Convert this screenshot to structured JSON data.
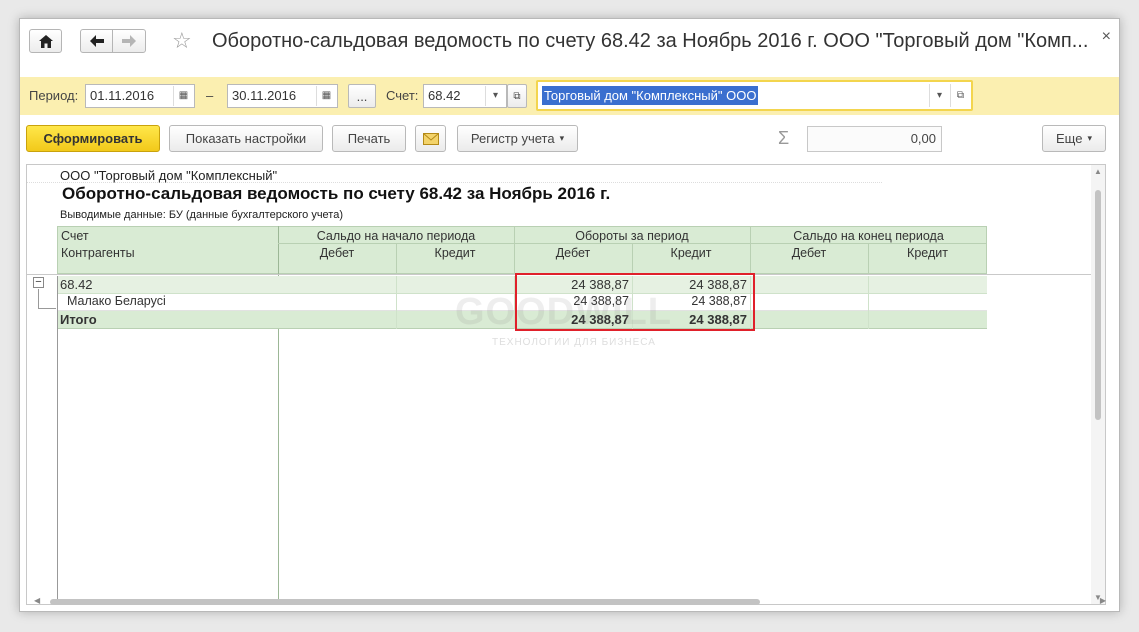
{
  "window": {
    "title": "Оборотно-сальдовая ведомость по счету 68.42 за Ноябрь 2016 г. ООО \"Торговый дом \"Комп...",
    "close_glyph": "×"
  },
  "params": {
    "period_label": "Период:",
    "date_from": "01.11.2016",
    "dash": "–",
    "date_to": "30.11.2016",
    "ellipsis_label": "...",
    "account_label": "Счет:",
    "account_value": "68.42",
    "organization_value": "Торговый дом \"Комплексный\" ООО"
  },
  "toolbar": {
    "generate_label": "Сформировать",
    "settings_label": "Показать настройки",
    "print_label": "Печать",
    "registry_label": "Регистр учета",
    "sigma": "Σ",
    "sum_value": "0,00",
    "more_label": "Еще"
  },
  "report": {
    "organization": "ООО \"Торговый дом \"Комплексный\"",
    "title": "Оборотно-сальдовая ведомость по счету 68.42 за Ноябрь 2016 г.",
    "output_data": "Выводимые данные:  БУ (данные бухгалтерского учета)",
    "headers": {
      "account": "Счет",
      "counterparties": "Контрагенты",
      "opening_balance": "Сальдо на начало периода",
      "turnover": "Обороты за период",
      "closing_balance": "Сальдо на конец периода",
      "debit": "Дебет",
      "credit": "Кредит"
    },
    "rows": [
      {
        "name": "68.42",
        "turnover_debit": "24 388,87",
        "turnover_credit": "24 388,87"
      },
      {
        "name": "Малако Беларусі",
        "turnover_debit": "24 388,87",
        "turnover_credit": "24 388,87"
      },
      {
        "name": "Итого",
        "turnover_debit": "24 388,87",
        "turnover_credit": "24 388,87"
      }
    ],
    "collapse_glyph": "−",
    "watermark": "GOODWILL",
    "watermark_sub": "ТЕХНОЛОГИИ ДЛЯ БИЗНЕСА"
  },
  "colors": {
    "params_bg": "#fbefb0",
    "primary_button": "#f2c91a",
    "header_bg": "#d9ebd4",
    "highlight_box": "#e0202a",
    "selection": "#3a6fcf"
  }
}
